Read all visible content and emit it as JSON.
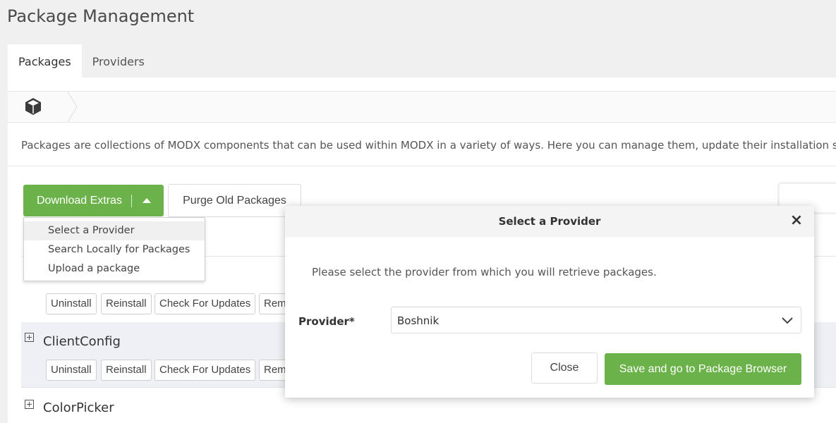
{
  "header": {
    "title": "Package Management"
  },
  "tabs": [
    {
      "label": "Packages"
    },
    {
      "label": "Providers"
    }
  ],
  "intro_text": "Packages are collections of MODX components that can be used within MODX in a variety of ways. Here you can manage them, update their installation status, di",
  "toolbar": {
    "download_label": "Download Extras",
    "purge_label": "Purge Old Packages"
  },
  "dropdown": {
    "items": [
      {
        "label": "Select a Provider"
      },
      {
        "label": "Search Locally for Packages"
      },
      {
        "label": "Upload a package"
      }
    ]
  },
  "actions": {
    "uninstall": "Uninstall",
    "reinstall": "Reinstall",
    "check_updates": "Check For Updates",
    "remove_partial": "Rem"
  },
  "packages": [
    {
      "name": "ClientConfig"
    },
    {
      "name": "ColorPicker"
    }
  ],
  "modal": {
    "title": "Select a Provider",
    "close_glyph": "×",
    "description": "Please select the provider from which you will retrieve packages.",
    "provider_label": "Provider*",
    "provider_value": "Boshnik",
    "close_button": "Close",
    "save_button": "Save and go to Package Browser"
  },
  "colors": {
    "accent": "#6cb24a",
    "background": "#f0f0f0"
  }
}
